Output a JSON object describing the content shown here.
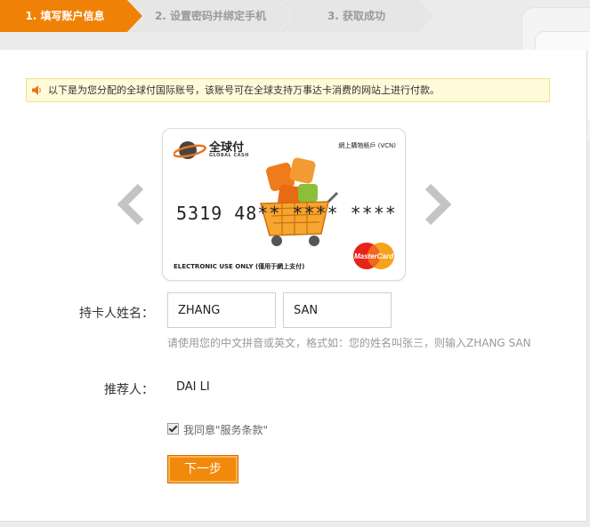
{
  "steps": [
    {
      "label": "1. 填写账户信息"
    },
    {
      "label": "2. 设置密码并绑定手机"
    },
    {
      "label": "3. 获取成功"
    }
  ],
  "notice": {
    "text": "以下是为您分配的全球付国际账号，该账号可在全球支持万事达卡消费的网站上进行付款。"
  },
  "card": {
    "brand": "全球付",
    "brand_sub": "GLOBAL CASH",
    "type_label": "網上購物賬戶 (VCN)",
    "number": "5319 48** **** ****",
    "usage": "ELECTRONIC USE ONLY (僅用于網上支付)",
    "network": "MasterCard"
  },
  "form": {
    "holder_label": "持卡人姓名：",
    "first_name": "ZHANG",
    "last_name": "SAN",
    "hint": "请使用您的中文拼音或英文，格式如：您的姓名叫张三，则输入ZHANG SAN",
    "referrer_label": "推荐人：",
    "referrer_value": "DAI LI",
    "agree_text": "我同意\"服务条款\"",
    "agree_checked": true,
    "next_label": "下一步"
  },
  "colors": {
    "accent": "#ef8206",
    "step_inactive": "#e6e6e6",
    "notice_bg": "#fffad9"
  }
}
